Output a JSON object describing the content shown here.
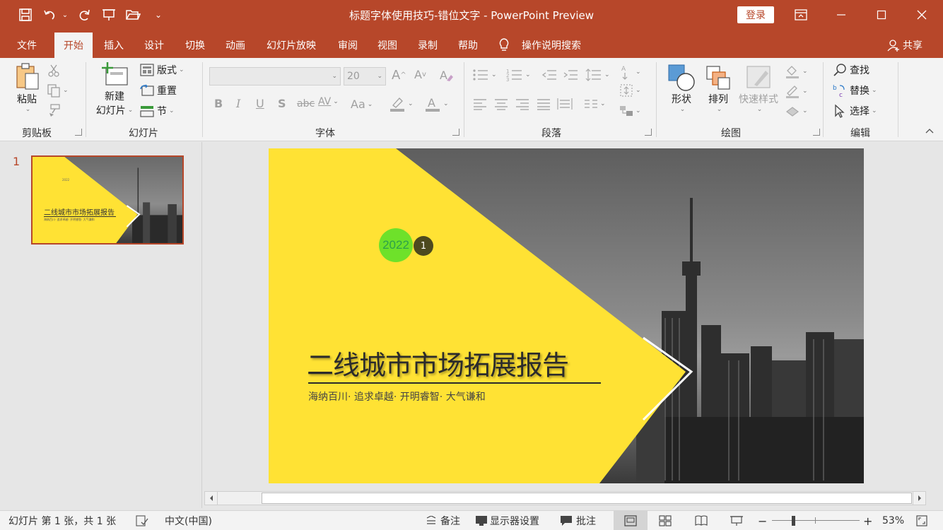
{
  "titlebar": {
    "document_title": "标题字体使用技巧-错位文字  -  PowerPoint Preview",
    "login_label": "登录",
    "bg": "#b7472a"
  },
  "tabs": [
    {
      "label": "文件"
    },
    {
      "label": "开始"
    },
    {
      "label": "插入"
    },
    {
      "label": "设计"
    },
    {
      "label": "切换"
    },
    {
      "label": "动画"
    },
    {
      "label": "幻灯片放映"
    },
    {
      "label": "审阅"
    },
    {
      "label": "视图"
    },
    {
      "label": "录制"
    },
    {
      "label": "帮助"
    }
  ],
  "tell_me": "操作说明搜索",
  "share": "共享",
  "ribbon": {
    "clipboard": {
      "paste": "粘贴",
      "label": "剪贴板"
    },
    "slides": {
      "new_slide_line1": "新建",
      "new_slide_line2": "幻灯片",
      "layout": "版式",
      "reset": "重置",
      "section": "节",
      "label": "幻灯片"
    },
    "font": {
      "font_size": "20",
      "bold": "B",
      "italic": "I",
      "underline": "U",
      "shadow": "S",
      "strike": "abc",
      "spacing": "AV",
      "case": "Aa",
      "label": "字体"
    },
    "paragraph": {
      "label": "段落"
    },
    "drawing": {
      "shapes": "形状",
      "arrange": "排列",
      "quick_styles": "快速样式",
      "label": "绘图"
    },
    "editing": {
      "find": "查找",
      "replace": "替换",
      "select": "选择",
      "label": "编辑"
    }
  },
  "thumbnail": {
    "number": "1",
    "year": "2022",
    "title": "二线城市市场拓展报告",
    "subtitle": "海纳百川· 追求卓越· 开明睿智· 大气谦和"
  },
  "slide": {
    "year": "2022",
    "badge": "1",
    "title": "二线城市市场拓展报告",
    "subtitle": "海纳百川· 追求卓越· 开明睿智· 大气谦和",
    "accent": "#ffe234",
    "year_circle": "#6ee12a"
  },
  "status": {
    "slide_info": "幻灯片 第 1 张，共 1 张",
    "language": "中文(中国)",
    "notes": "备注",
    "display_settings": "显示器设置",
    "comments": "批注",
    "zoom": "53%"
  }
}
